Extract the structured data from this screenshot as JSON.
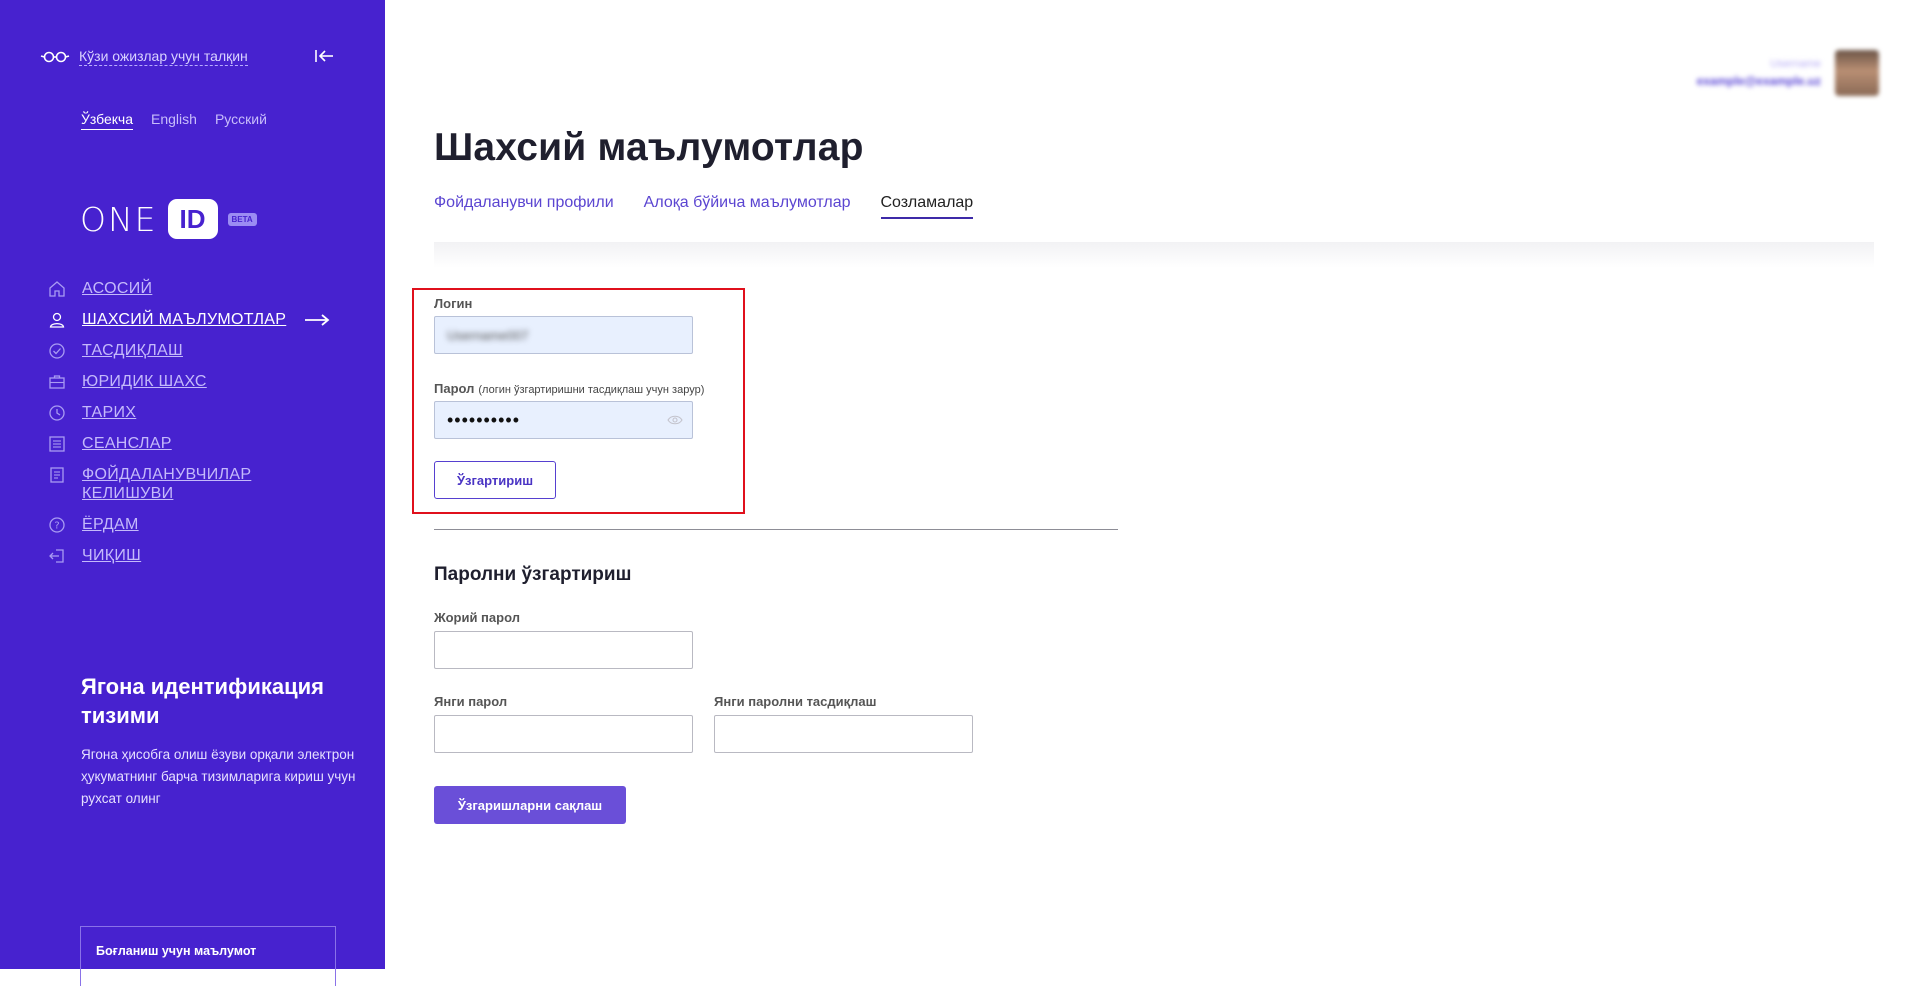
{
  "sidebar": {
    "accessibility_label": "Кўзи ожизлар учун талқин",
    "languages": [
      {
        "label": "Ўзбекча",
        "active": true
      },
      {
        "label": "English",
        "active": false
      },
      {
        "label": "Русский",
        "active": false
      }
    ],
    "logo_text": "ONE",
    "logo_mark": "ID",
    "logo_badge": "BETA",
    "nav": [
      {
        "label": "АСОСИЙ",
        "icon": "home-icon",
        "active": false
      },
      {
        "label": "ШАХСИЙ МАЪЛУМОТЛАР",
        "icon": "user-icon",
        "active": true
      },
      {
        "label": "ТАСДИҚЛАШ",
        "icon": "check-circle-icon",
        "active": false
      },
      {
        "label": "ЮРИДИК ШАХС",
        "icon": "briefcase-icon",
        "active": false
      },
      {
        "label": "ТАРИХ",
        "icon": "clock-icon",
        "active": false
      },
      {
        "label": "СЕАНСЛАР",
        "icon": "list-icon",
        "active": false
      },
      {
        "label": "ФОЙДАЛАНУВЧИЛАР КЕЛИШУВИ",
        "icon": "document-icon",
        "active": false
      },
      {
        "label": "ЁРДАМ",
        "icon": "help-icon",
        "active": false
      },
      {
        "label": "ЧИҚИШ",
        "icon": "logout-icon",
        "active": false
      }
    ],
    "promo_title": "Ягона идентификация тизими",
    "promo_text": "Ягона ҳисобга олиш ёзуви орқали электрон ҳукуматнинг барча тизимларига кириш учун рухсат олинг",
    "contact_label": "Боғланиш учун маълумот"
  },
  "header": {
    "user_name": "Username",
    "user_email": "example@example.uz"
  },
  "main": {
    "title": "Шахсий маълумотлар",
    "tabs": [
      {
        "label": "Фойдаланувчи профили",
        "active": false
      },
      {
        "label": "Алоқа бўйича маълумотлар",
        "active": false
      },
      {
        "label": "Созламалар",
        "active": true
      }
    ],
    "login_form": {
      "login_label": "Логин",
      "login_value": "Username007",
      "password_label": "Парол",
      "password_note": "(логин ўзгартиришни тасдиқлаш учун зарур)",
      "password_value": "••••••••••",
      "change_button": "Ўзгартириш"
    },
    "password_form": {
      "section_title": "Паролни ўзгартириш",
      "current_label": "Жорий парол",
      "new_label": "Янги парол",
      "confirm_label": "Янги паролни тасдиқлаш",
      "save_button": "Ўзгаришларни сақлаш"
    }
  },
  "colors": {
    "sidebar_bg": "#4722cf",
    "accent": "#6a4fd8",
    "highlight_box": "#e0101c"
  }
}
